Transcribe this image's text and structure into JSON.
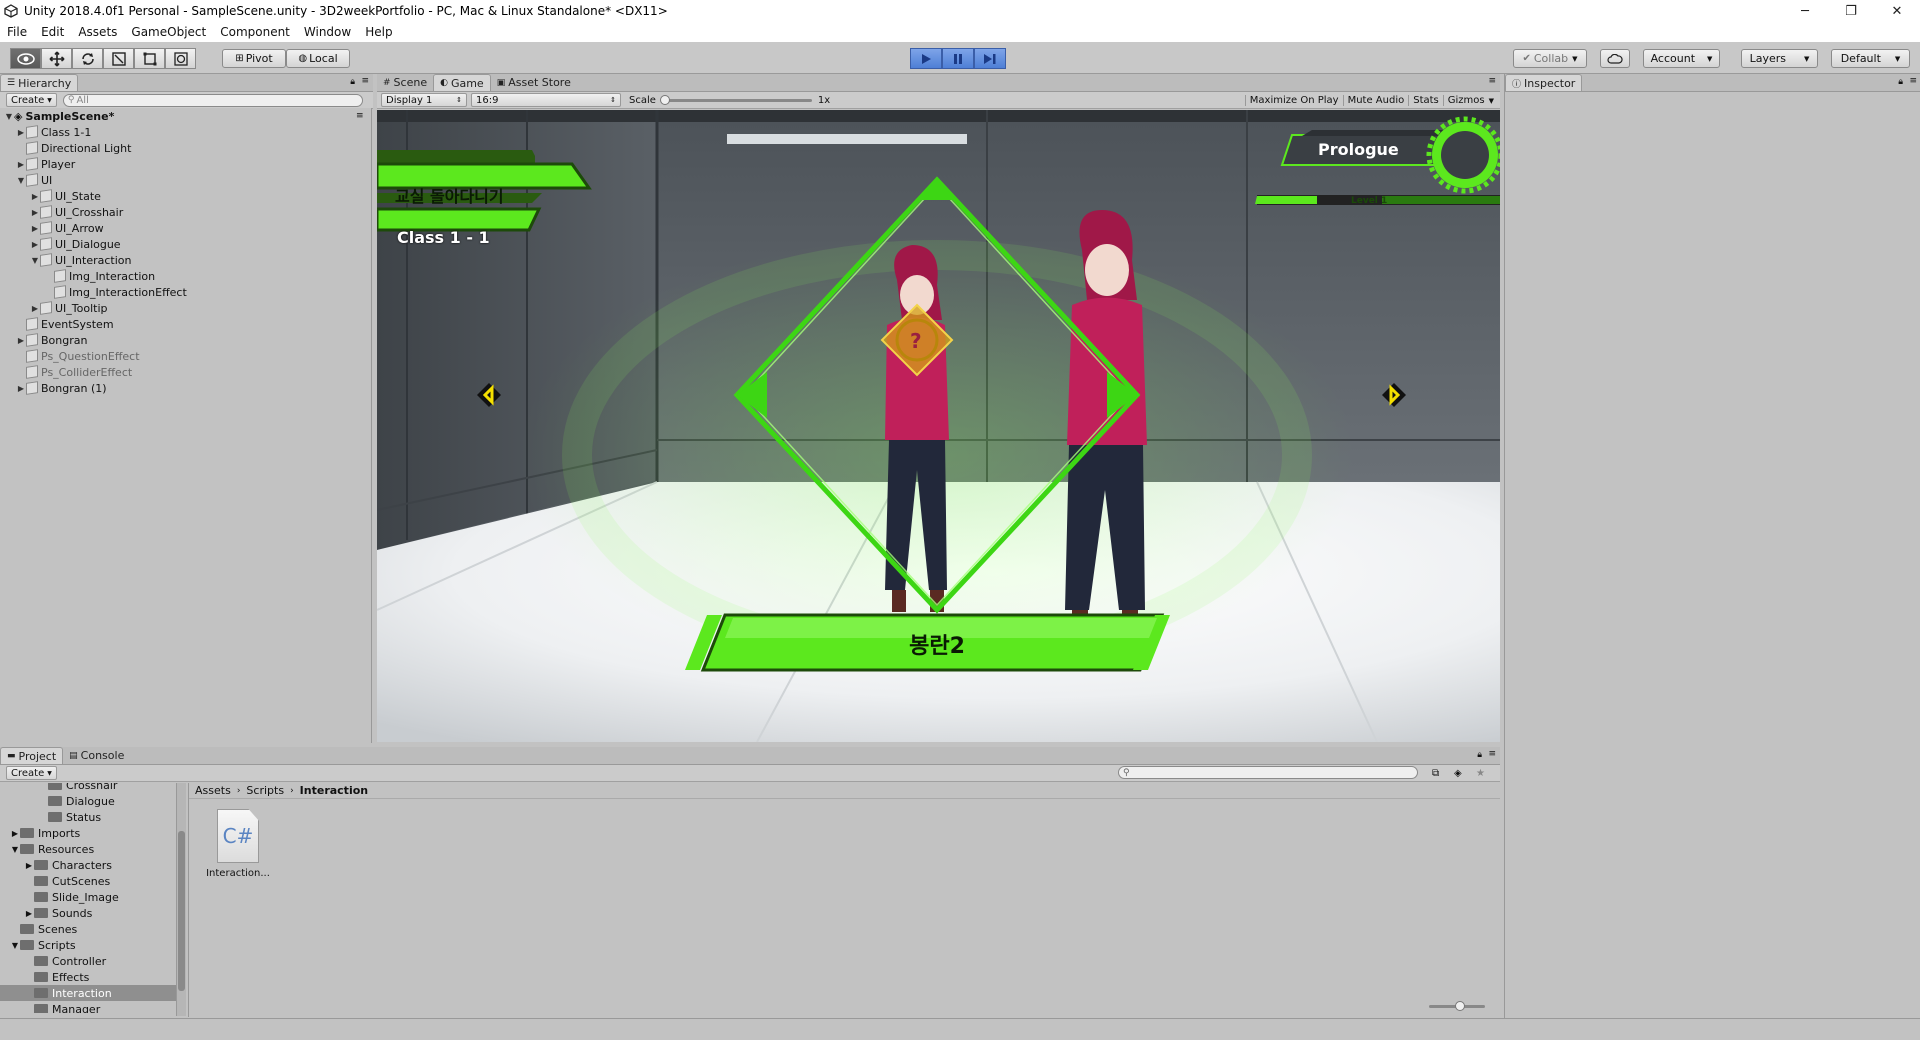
{
  "window": {
    "title": "Unity 2018.4.0f1 Personal - SampleScene.unity - 3D2weekPortfolio - PC, Mac & Linux Standalone* <DX11>",
    "minimize": "─",
    "restore": "❐",
    "close": "✕"
  },
  "menu": [
    "File",
    "Edit",
    "Assets",
    "GameObject",
    "Component",
    "Window",
    "Help"
  ],
  "toolbar": {
    "pivot": "Pivot",
    "local": "Local",
    "collab": "Collab",
    "account": "Account",
    "layers": "Layers",
    "layout": "Default"
  },
  "hierarchy": {
    "tab": "Hierarchy",
    "create": "Create",
    "search_placeholder": "All",
    "scene": "SampleScene*",
    "items": [
      {
        "label": "Class 1-1",
        "depth": 1,
        "arrow": "right"
      },
      {
        "label": "Directional Light",
        "depth": 1,
        "arrow": ""
      },
      {
        "label": "Player",
        "depth": 1,
        "arrow": "right"
      },
      {
        "label": "UI",
        "depth": 1,
        "arrow": "down"
      },
      {
        "label": "UI_State",
        "depth": 2,
        "arrow": "right"
      },
      {
        "label": "UI_Crosshair",
        "depth": 2,
        "arrow": "right"
      },
      {
        "label": "UI_Arrow",
        "depth": 2,
        "arrow": "right"
      },
      {
        "label": "UI_Dialogue",
        "depth": 2,
        "arrow": "right"
      },
      {
        "label": "UI_Interaction",
        "depth": 2,
        "arrow": "down"
      },
      {
        "label": "Img_Interaction",
        "depth": 3,
        "arrow": ""
      },
      {
        "label": "Img_InteractionEffect",
        "depth": 3,
        "arrow": ""
      },
      {
        "label": "UI_Tooltip",
        "depth": 2,
        "arrow": "right"
      },
      {
        "label": "EventSystem",
        "depth": 1,
        "arrow": ""
      },
      {
        "label": "Bongran",
        "depth": 1,
        "arrow": "right"
      },
      {
        "label": "Ps_QuestionEffect",
        "depth": 1,
        "arrow": "",
        "dim": true
      },
      {
        "label": "Ps_ColliderEffect",
        "depth": 1,
        "arrow": "",
        "dim": true
      },
      {
        "label": "Bongran (1)",
        "depth": 1,
        "arrow": "right"
      }
    ]
  },
  "view_tabs": {
    "scene": "Scene",
    "game": "Game",
    "asset_store": "Asset Store"
  },
  "game_bar": {
    "display": "Display 1",
    "aspect": "16:9",
    "scale_label": "Scale",
    "scale_value": "1x",
    "maximize": "Maximize On Play",
    "mute": "Mute Audio",
    "stats": "Stats",
    "gizmos": "Gizmos"
  },
  "game_view": {
    "location": "교실 돌아다니기",
    "room": "Class 1 - 1",
    "chapter": "Prologue",
    "level": "Level 1",
    "name_plate": "봉란2",
    "question": "?",
    "level_progress": 0.08
  },
  "bottom_tabs": {
    "project": "Project",
    "console": "Console",
    "create": "Create"
  },
  "project_tree": [
    {
      "label": "Crosshair",
      "depth": 3,
      "arrow": ""
    },
    {
      "label": "Dialogue",
      "depth": 3,
      "arrow": ""
    },
    {
      "label": "Status",
      "depth": 3,
      "arrow": ""
    },
    {
      "label": "Imports",
      "depth": 1,
      "arrow": "right"
    },
    {
      "label": "Resources",
      "depth": 1,
      "arrow": "down"
    },
    {
      "label": "Characters",
      "depth": 2,
      "arrow": "right"
    },
    {
      "label": "CutScenes",
      "depth": 2,
      "arrow": ""
    },
    {
      "label": "Slide_Image",
      "depth": 2,
      "arrow": ""
    },
    {
      "label": "Sounds",
      "depth": 2,
      "arrow": "right"
    },
    {
      "label": "Scenes",
      "depth": 1,
      "arrow": ""
    },
    {
      "label": "Scripts",
      "depth": 1,
      "arrow": "down"
    },
    {
      "label": "Controller",
      "depth": 2,
      "arrow": ""
    },
    {
      "label": "Effects",
      "depth": 2,
      "arrow": ""
    },
    {
      "label": "Interaction",
      "depth": 2,
      "arrow": "",
      "selected": true
    },
    {
      "label": "Manager",
      "depth": 2,
      "arrow": ""
    }
  ],
  "breadcrumb": [
    "Assets",
    "Scripts",
    "Interaction"
  ],
  "asset": {
    "icon_text": "C#",
    "label": "Interaction..."
  },
  "inspector": {
    "tab": "Inspector"
  }
}
